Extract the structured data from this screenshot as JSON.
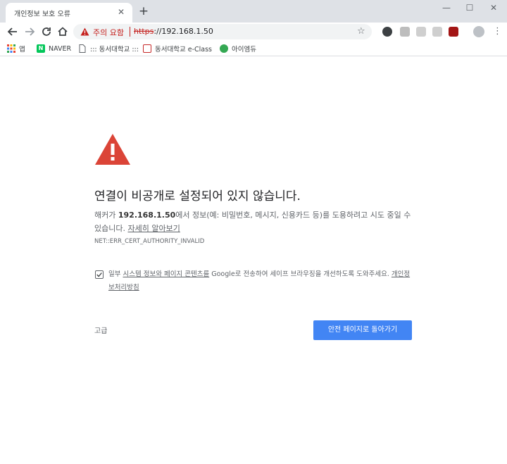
{
  "tab": {
    "title": "개인정보 보호 오류",
    "close": "✕",
    "new_tab": "+"
  },
  "window": {
    "minimize": "—",
    "maximize": "☐",
    "close": "✕"
  },
  "omnibox": {
    "security_label": "주의 요함",
    "url_scheme": "https",
    "url_rest": "://192.168.1.50"
  },
  "bookmarks": {
    "apps": "앱",
    "items": [
      "NAVER",
      "::: 동서대학교 :::",
      "동서대학교 e-Class",
      "아이엠듀"
    ]
  },
  "interstitial": {
    "heading": "연결이 비공개로 설정되어 있지 않습니다.",
    "desc_prefix": "해커가 ",
    "desc_host": "192.168.1.50",
    "desc_suffix": "에서 정보(예: 비밀번호, 메시지, 신용카드 등)를 도용하려고 시도 중일 수 있습니다. ",
    "learn_more": "자세히 알아보기",
    "error_code": "NET::ERR_CERT_AUTHORITY_INVALID",
    "checkbox_prefix": "일부 ",
    "checkbox_link1": "시스템 정보와 페이지 콘텐츠를",
    "checkbox_middle": " Google로 전송하여 세이프 브라우징을 개선하도록 도와주세요. ",
    "checkbox_link2": "개인정보처리방침",
    "advanced": "고급",
    "back_button": "안전 페이지로 돌아가기"
  },
  "colors": {
    "warning_red": "#db4437",
    "primary_blue": "#4285f4"
  }
}
